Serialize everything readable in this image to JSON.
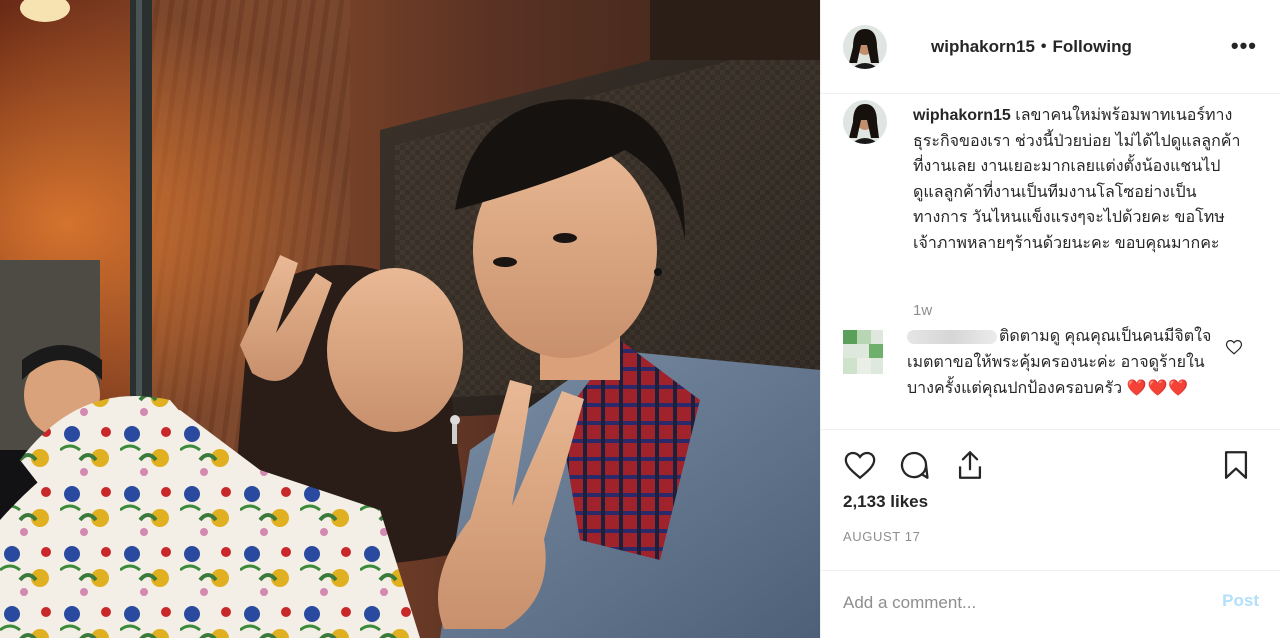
{
  "post": {
    "username": "wiphakorn15",
    "separator": "•",
    "follow_status": "Following",
    "more_label": "•••"
  },
  "caption": {
    "username": "wiphakorn15",
    "text": " เลขาคนใหม่พร้อมพาทเนอร์ทางธุระกิจของเรา ช่วงนี้ป่วยบ่อย ไม่ได้ไปดูแลลูกค้าที่งานเลย งานเยอะมากเลยแต่งตั้งน้องแชนไปดูแลลูกค้าที่งานเป็นทีมงานโลโซอย่างเป็นทางการ วันไหนแข็งแรงๆจะไปด้วยคะ ขอโทษเจ้าภาพหลายๆร้านด้วยนะคะ ขอบคุณมากคะ",
    "time": "1w"
  },
  "comment": {
    "text": "ติดตามดู คุณคุณเป็นคนมีจิตใจเมตตาขอให้พระคุ้มครองนะค่ะ อาจดูร้ายในบางครั้งแต่คุณปกป้องครอบครัว ",
    "hearts": "❤️❤️❤️"
  },
  "actions": {
    "like_icon": "heart-outline-icon",
    "comment_icon": "speech-bubble-icon",
    "share_icon": "share-upload-icon",
    "save_icon": "bookmark-icon"
  },
  "likes": "2,133 likes",
  "date": "AUGUST 17",
  "add_comment": {
    "placeholder": "Add a comment...",
    "post_label": "Post"
  },
  "colors": {
    "text": "#262626",
    "muted": "#8e8e8e",
    "post_disabled": "#b2dffc",
    "border": "#efefef"
  }
}
